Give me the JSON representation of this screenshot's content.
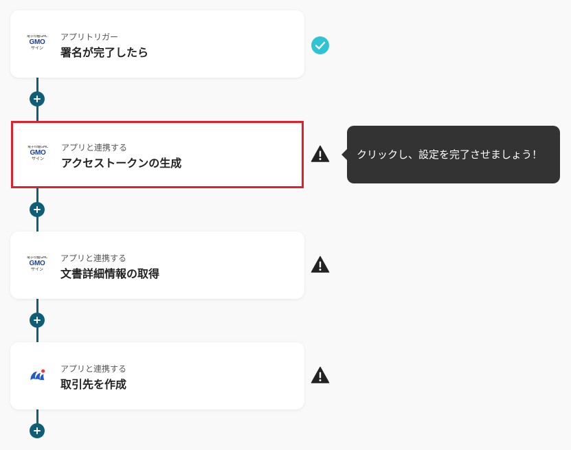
{
  "steps": [
    {
      "subtitle": "アプリトリガー",
      "title": "署名が完了したら",
      "app": {
        "icon": "gmo-sign-logo",
        "top": "電子印鑑GMO",
        "main": "GMO",
        "sub": "サイン"
      },
      "status": "complete"
    },
    {
      "subtitle": "アプリと連携する",
      "title": "アクセストークンの生成",
      "app": {
        "icon": "gmo-sign-logo",
        "top": "電子印鑑GMO",
        "main": "GMO",
        "sub": "サイン"
      },
      "status": "warning"
    },
    {
      "subtitle": "アプリと連携する",
      "title": "文書詳細情報の取得",
      "app": {
        "icon": "gmo-sign-logo",
        "top": "電子印鑑GMO",
        "main": "GMO",
        "sub": "サイン"
      },
      "status": "warning"
    },
    {
      "subtitle": "アプリと連携する",
      "title": "取引先を作成",
      "app": {
        "icon": "freee-style-logo"
      },
      "status": "warning"
    }
  ],
  "tooltip": {
    "text": "クリックし、設定を完了させましょう！"
  },
  "colors": {
    "connector": "#0e5f75",
    "highlight_border": "#e0202a",
    "check": "#2ec4d6",
    "warning": "#222222",
    "tooltip_bg": "#333333",
    "gmo_blue": "#1a3f9c"
  }
}
